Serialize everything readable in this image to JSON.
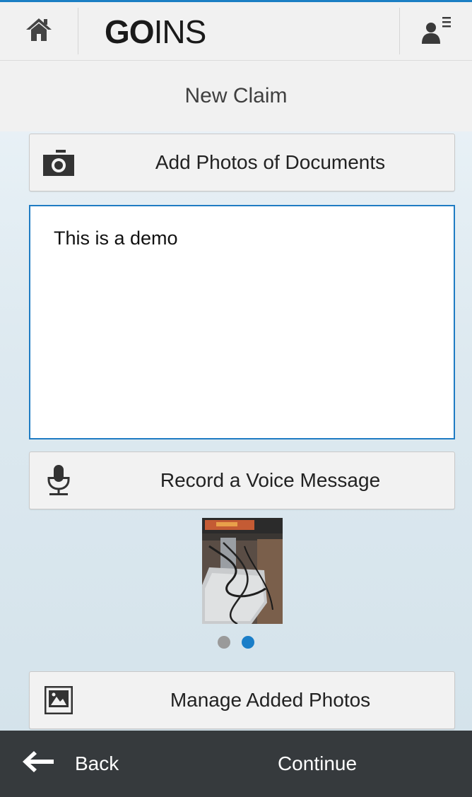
{
  "header": {
    "logo_bold": "GO",
    "logo_rest": "INS",
    "home_icon": "home-icon",
    "user_icon": "user-menu-icon"
  },
  "title": "New Claim",
  "buttons": {
    "add_photos": "Add Photos of Documents",
    "record_voice": "Record a Voice Message",
    "manage_photos": "Manage Added Photos"
  },
  "note": {
    "text": "This is a demo"
  },
  "carousel": {
    "page_count": 2,
    "active_index": 1
  },
  "footer": {
    "back": "Back",
    "continue": "Continue"
  },
  "colors": {
    "accent": "#1a7ec8",
    "footer_bg": "#363a3d",
    "header_bg": "#f1f1f1"
  }
}
